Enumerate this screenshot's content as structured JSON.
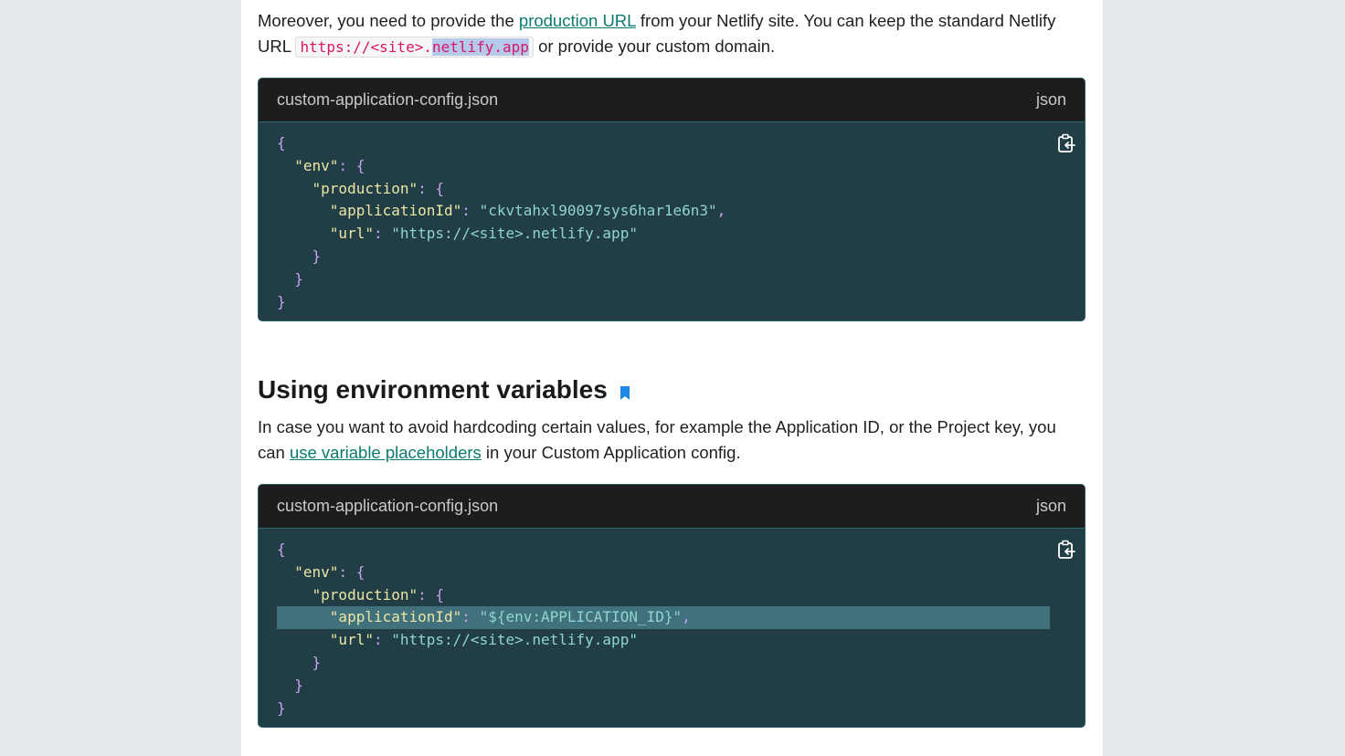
{
  "intro": {
    "text_before_link": "Moreover, you need to provide the ",
    "link_text": "production URL",
    "text_after_link": " from your Netlify site. You can keep the standard Netlify URL ",
    "inline_code_before_sel": "https://<site>.",
    "inline_code_selected": "netlify.app",
    "text_end": " or provide your custom domain."
  },
  "code_block_1": {
    "filename": "custom-application-config.json",
    "language": "json",
    "application_id": "\"ckvtahxl90097sys6har1e6n3\"",
    "url_value": "\"https://<site>.netlify.app\""
  },
  "section": {
    "title": "Using environment variables",
    "icon": "bookmark-icon"
  },
  "para2": {
    "text_before_link": "In case you want to avoid hardcoding certain values, for example the Application ID, or the Project key, you can ",
    "link_text": "use variable placeholders",
    "text_after_link": " in your Custom Application config."
  },
  "code_block_2": {
    "filename": "custom-application-config.json",
    "language": "json",
    "application_id": "\"${env:APPLICATION_ID}\"",
    "url_value": "\"https://<site>.netlify.app\""
  },
  "code_tokens": {
    "open_brace": "{",
    "close_brace": "}",
    "key_env": "\"env\"",
    "key_production": "\"production\"",
    "key_application_id": "\"applicationId\"",
    "key_url": "\"url\"",
    "colon_open": ": {",
    "colon": ": ",
    "comma": ","
  },
  "colors": {
    "link": "#0b7a6f",
    "code_bg": "#213d46",
    "code_header_bg": "#1d1d1d",
    "highlight_line": "#41717d",
    "bookmark": "#1e88e5",
    "inline_code": "#d6166a"
  }
}
